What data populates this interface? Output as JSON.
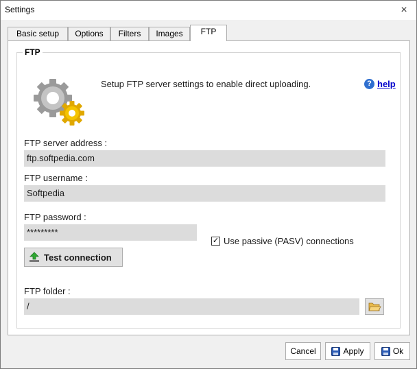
{
  "window": {
    "title": "Settings"
  },
  "tabs": [
    {
      "label": "Basic setup"
    },
    {
      "label": "Options"
    },
    {
      "label": "Filters"
    },
    {
      "label": "Images"
    },
    {
      "label": "FTP",
      "active": true
    }
  ],
  "group": {
    "title": "FTP"
  },
  "description": "Setup FTP server settings to enable direct uploading.",
  "help_label": "help",
  "fields": {
    "server": {
      "label": "FTP server address :",
      "value": "ftp.softpedia.com"
    },
    "username": {
      "label": "FTP username :",
      "value": "Softpedia"
    },
    "password": {
      "label": "FTP password :",
      "value": "*********"
    },
    "folder": {
      "label": "FTP folder :",
      "value": "/"
    }
  },
  "passive": {
    "label": "Use passive (PASV) connections",
    "checked": true,
    "mark": "✓"
  },
  "test_button": "Test connection",
  "buttons": {
    "cancel": "Cancel",
    "apply": "Apply",
    "ok": "Ok"
  },
  "icons": {
    "close": "×",
    "help": "?"
  }
}
